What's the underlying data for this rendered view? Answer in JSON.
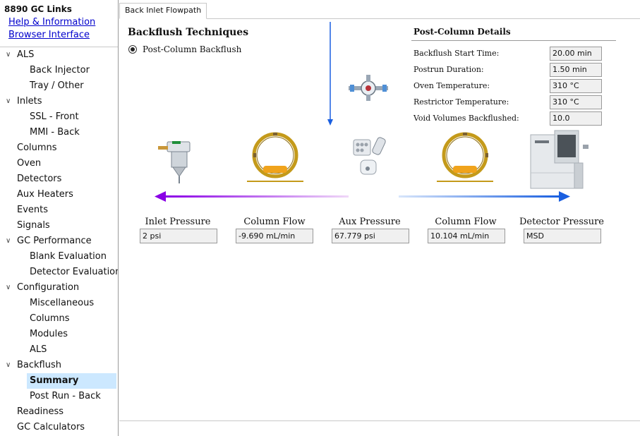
{
  "sidebar": {
    "title": "8890 GC Links",
    "links": [
      "Help & Information",
      "Browser Interface"
    ],
    "items": [
      {
        "label": "ALS",
        "chevron": "v"
      },
      {
        "label": "Back Injector"
      },
      {
        "label": "Tray / Other"
      },
      {
        "label": "Inlets",
        "chevron": "v"
      },
      {
        "label": "SSL - Front"
      },
      {
        "label": "MMI - Back"
      },
      {
        "label": "Columns"
      },
      {
        "label": "Oven"
      },
      {
        "label": "Detectors"
      },
      {
        "label": "Aux Heaters"
      },
      {
        "label": "Events"
      },
      {
        "label": "Signals"
      },
      {
        "label": "GC Performance",
        "chevron": "v"
      },
      {
        "label": "Blank Evaluation"
      },
      {
        "label": "Detector Evaluation"
      },
      {
        "label": "Configuration",
        "chevron": "v"
      },
      {
        "label": "Miscellaneous"
      },
      {
        "label": "Columns"
      },
      {
        "label": "Modules"
      },
      {
        "label": "ALS"
      },
      {
        "label": "Backflush",
        "chevron": "v"
      },
      {
        "label": "Summary"
      },
      {
        "label": "Post Run - Back"
      },
      {
        "label": "Readiness"
      },
      {
        "label": "GC Calculators"
      }
    ]
  },
  "tab": {
    "label": "Back Inlet Flowpath"
  },
  "backflush": {
    "title": "Backflush Techniques",
    "option": "Post-Column Backflush"
  },
  "post_column": {
    "title": "Post-Column Details",
    "rows": [
      {
        "label": "Backflush Start Time:",
        "value": "20.00 min"
      },
      {
        "label": "Postrun Duration:",
        "value": "1.50 min"
      },
      {
        "label": "Oven Temperature:",
        "value": "310 °C"
      },
      {
        "label": "Restrictor Temperature:",
        "value": "310 °C"
      },
      {
        "label": "Void Volumes Backflushed:",
        "value": "10.0"
      }
    ]
  },
  "flow": {
    "inlet_pressure": {
      "label": "Inlet Pressure",
      "value": "2 psi"
    },
    "column_flow_1": {
      "label": "Column Flow",
      "value": "-9.690 mL/min"
    },
    "aux_pressure": {
      "label": "Aux Pressure",
      "value": "67.779 psi"
    },
    "column_flow_2": {
      "label": "Column Flow",
      "value": "10.104 mL/min"
    },
    "detector_pressure": {
      "label": "Detector Pressure",
      "value": "MSD"
    }
  },
  "colors": {
    "selected_bg": "#cce8ff",
    "arrow_left": "#8a00e6",
    "arrow_right": "#1a5fe0",
    "column_gold": "#c49a1a"
  }
}
